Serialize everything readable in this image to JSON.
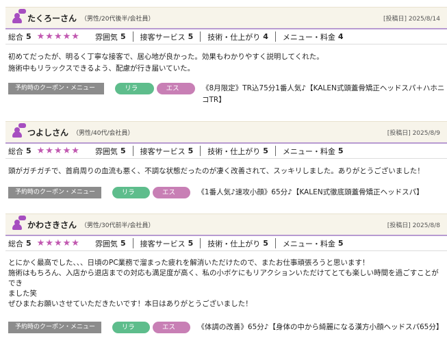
{
  "rating_labels": {
    "overall": "総合",
    "atmosphere": "雰囲気",
    "service": "接客サービス",
    "technique": "技術・仕上がり",
    "menu_price": "メニュー・料金"
  },
  "coupon_label": "予約時のクーポン・メニュー",
  "tags": {
    "relax": "リラク",
    "esthe": "エステ"
  },
  "reviews": [
    {
      "name": "たくろーさん",
      "meta": "（男性/20代後半/会社員）",
      "date": "[投稿日] 2025/8/14",
      "overall": "5",
      "stars": "★★★★★",
      "atmosphere": "5",
      "service": "5",
      "technique": "4",
      "menu_price": "4",
      "text_lines": [
        "初めてだったが、明るく丁寧な接客で、居心地が良かった。効果もわかりやすく説明してくれた。",
        "施術中もリラックスできるよう、配慮が行き届いていた。"
      ],
      "coupon": "《8月限定》TR込75分1番人気♪【KALEN式頭蓋骨矯正ヘッドスパ＋ハホニコTR】"
    },
    {
      "name": "つよしさん",
      "meta": "（男性/40代/会社員）",
      "date": "[投稿日] 2025/8/9",
      "overall": "5",
      "stars": "★★★★★",
      "atmosphere": "5",
      "service": "5",
      "technique": "5",
      "menu_price": "5",
      "text_lines": [
        "頭がガチガチで、首肩周りの血流も悪く、不調な状態だったのが凄く改善されて、スッキリしました。ありがとうございました！"
      ],
      "coupon": "《1番人気♪速攻小顔》65分♪【KALEN式徹底頭蓋骨矯正ヘッドスパ】"
    },
    {
      "name": "かわさきさん",
      "meta": "（男性/30代前半/会社員）",
      "date": "[投稿日] 2025/8/8",
      "overall": "5",
      "stars": "★★★★★",
      "atmosphere": "5",
      "service": "5",
      "technique": "5",
      "menu_price": "5",
      "text_lines": [
        "とにかく最高でした、、、日頃のPC業務で溜まった疲れを解消いただけたので、またお仕事頑張ろうと思います！",
        "施術はもちろん、入店から退店までの対応も満足度が高く、私の小ボケにもリアクションいただけてとても楽しい時間を過ごすことができ",
        "ました笑",
        "ぜひまたお願いさせていただきたいです！本日はありがとうございました！"
      ],
      "coupon": "《体調の改善》65分♪【身体の中から綺麗になる漢方小顔ヘッドスパ65分】"
    }
  ]
}
